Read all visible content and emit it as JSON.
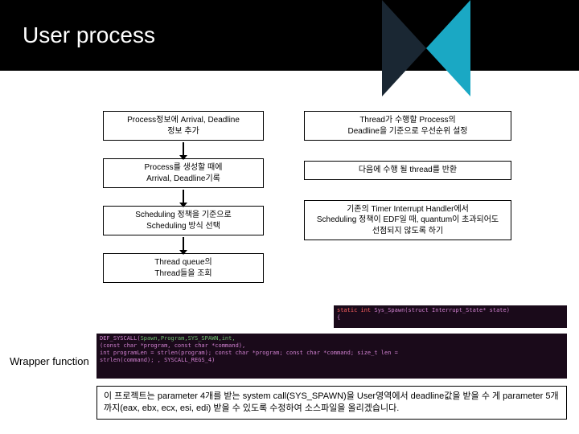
{
  "header": {
    "title": "User process"
  },
  "leftFlow": {
    "b1_l1": "Process정보에 Arrival, Deadline",
    "b1_l2": "정보 추가",
    "b2_l1": "Process를 생성할 때에",
    "b2_l2": "Arrival, Deadline기록",
    "b3_l1": "Scheduling 정책을 기준으로",
    "b3_l2": "Scheduling 방식 선택",
    "b4_l1": "Thread queue의",
    "b4_l2": "Thread들을 조회"
  },
  "rightFlow": {
    "b1_l1": "Thread가 수행할 Process의",
    "b1_l2": "Deadline을 기준으로 우선순위 설정",
    "b2_l1": "다음에 수행 될 thread를 반환",
    "b3_l1": "기존의 Timer Interrupt Handler에서",
    "b3_l2": "Scheduling 정책이 EDF일 때,  quantum이 초과되어도",
    "b3_l3": "선점되지 않도록 하기"
  },
  "code1": {
    "line1a": "static int ",
    "line1b": "Sys_Spawn",
    "line1c": "(struct Interrupt_State* state)",
    "line2": "{"
  },
  "code2": {
    "line1a": "DEF_SYSCALL(",
    "line1b": "Spawn,Program,SYS_SPAWN,int,",
    "line2": "  (const char *program,  const char *command),",
    "line3a": "  int programLen = strlen(program); const char *program; const char *command; size_t len =",
    "line4a": "  strlen(command); , SYSCALL_REGS_4)"
  },
  "wrapperLabel": "Wrapper function",
  "bottomNote": "이 프로젝트는 parameter 4개를 받는 system call(SYS_SPAWN)을 User영역에서 deadline값을 받을 수 게 parameter 5개까지(eax, ebx, ecx, esi, edi) 받을 수 있도록 수정하여 소스파일을 올리겠습니다."
}
